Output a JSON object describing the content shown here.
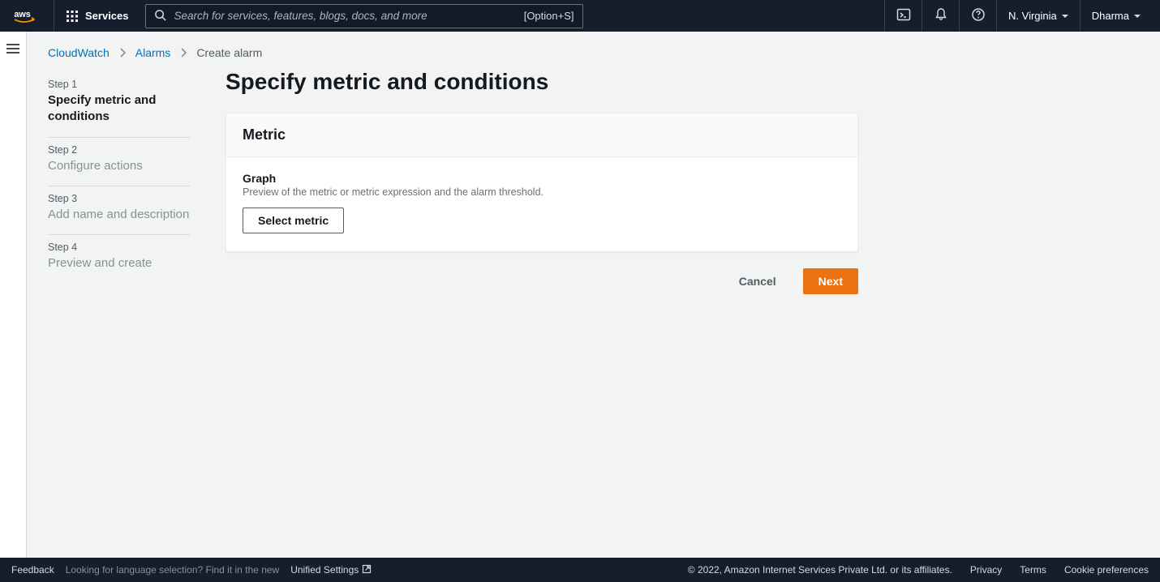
{
  "topnav": {
    "services_label": "Services",
    "search_placeholder": "Search for services, features, blogs, docs, and more",
    "search_hint": "[Option+S]",
    "region": "N. Virginia",
    "account": "Dharma"
  },
  "breadcrumb": {
    "root": "CloudWatch",
    "mid": "Alarms",
    "current": "Create alarm"
  },
  "wizard": {
    "steps": [
      {
        "num": "Step 1",
        "label": "Specify metric and conditions"
      },
      {
        "num": "Step 2",
        "label": "Configure actions"
      },
      {
        "num": "Step 3",
        "label": "Add name and description"
      },
      {
        "num": "Step 4",
        "label": "Preview and create"
      }
    ]
  },
  "page": {
    "title": "Specify metric and conditions",
    "panel_title": "Metric",
    "graph_title": "Graph",
    "graph_desc": "Preview of the metric or metric expression and the alarm threshold.",
    "select_metric": "Select metric",
    "cancel": "Cancel",
    "next": "Next"
  },
  "footer": {
    "feedback": "Feedback",
    "lang_hint": "Looking for language selection? Find it in the new",
    "unified": "Unified Settings",
    "copyright": "© 2022, Amazon Internet Services Private Ltd. or its affiliates.",
    "privacy": "Privacy",
    "terms": "Terms",
    "cookies": "Cookie preferences"
  }
}
